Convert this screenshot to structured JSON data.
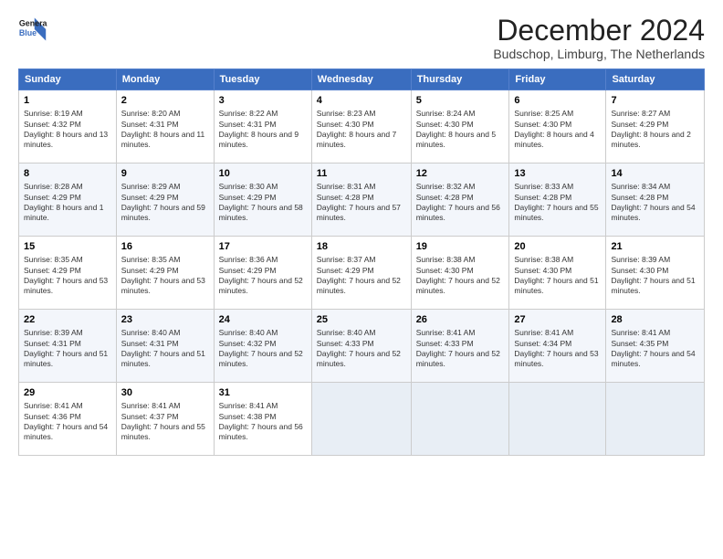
{
  "header": {
    "logo_line1": "General",
    "logo_line2": "Blue",
    "main_title": "December 2024",
    "subtitle": "Budschop, Limburg, The Netherlands"
  },
  "weekdays": [
    "Sunday",
    "Monday",
    "Tuesday",
    "Wednesday",
    "Thursday",
    "Friday",
    "Saturday"
  ],
  "weeks": [
    [
      {
        "day": "1",
        "sunrise": "8:19 AM",
        "sunset": "4:32 PM",
        "daylight": "8 hours and 13 minutes."
      },
      {
        "day": "2",
        "sunrise": "8:20 AM",
        "sunset": "4:31 PM",
        "daylight": "8 hours and 11 minutes."
      },
      {
        "day": "3",
        "sunrise": "8:22 AM",
        "sunset": "4:31 PM",
        "daylight": "8 hours and 9 minutes."
      },
      {
        "day": "4",
        "sunrise": "8:23 AM",
        "sunset": "4:30 PM",
        "daylight": "8 hours and 7 minutes."
      },
      {
        "day": "5",
        "sunrise": "8:24 AM",
        "sunset": "4:30 PM",
        "daylight": "8 hours and 5 minutes."
      },
      {
        "day": "6",
        "sunrise": "8:25 AM",
        "sunset": "4:30 PM",
        "daylight": "8 hours and 4 minutes."
      },
      {
        "day": "7",
        "sunrise": "8:27 AM",
        "sunset": "4:29 PM",
        "daylight": "8 hours and 2 minutes."
      }
    ],
    [
      {
        "day": "8",
        "sunrise": "8:28 AM",
        "sunset": "4:29 PM",
        "daylight": "8 hours and 1 minute."
      },
      {
        "day": "9",
        "sunrise": "8:29 AM",
        "sunset": "4:29 PM",
        "daylight": "7 hours and 59 minutes."
      },
      {
        "day": "10",
        "sunrise": "8:30 AM",
        "sunset": "4:29 PM",
        "daylight": "7 hours and 58 minutes."
      },
      {
        "day": "11",
        "sunrise": "8:31 AM",
        "sunset": "4:28 PM",
        "daylight": "7 hours and 57 minutes."
      },
      {
        "day": "12",
        "sunrise": "8:32 AM",
        "sunset": "4:28 PM",
        "daylight": "7 hours and 56 minutes."
      },
      {
        "day": "13",
        "sunrise": "8:33 AM",
        "sunset": "4:28 PM",
        "daylight": "7 hours and 55 minutes."
      },
      {
        "day": "14",
        "sunrise": "8:34 AM",
        "sunset": "4:28 PM",
        "daylight": "7 hours and 54 minutes."
      }
    ],
    [
      {
        "day": "15",
        "sunrise": "8:35 AM",
        "sunset": "4:29 PM",
        "daylight": "7 hours and 53 minutes."
      },
      {
        "day": "16",
        "sunrise": "8:35 AM",
        "sunset": "4:29 PM",
        "daylight": "7 hours and 53 minutes."
      },
      {
        "day": "17",
        "sunrise": "8:36 AM",
        "sunset": "4:29 PM",
        "daylight": "7 hours and 52 minutes."
      },
      {
        "day": "18",
        "sunrise": "8:37 AM",
        "sunset": "4:29 PM",
        "daylight": "7 hours and 52 minutes."
      },
      {
        "day": "19",
        "sunrise": "8:38 AM",
        "sunset": "4:30 PM",
        "daylight": "7 hours and 52 minutes."
      },
      {
        "day": "20",
        "sunrise": "8:38 AM",
        "sunset": "4:30 PM",
        "daylight": "7 hours and 51 minutes."
      },
      {
        "day": "21",
        "sunrise": "8:39 AM",
        "sunset": "4:30 PM",
        "daylight": "7 hours and 51 minutes."
      }
    ],
    [
      {
        "day": "22",
        "sunrise": "8:39 AM",
        "sunset": "4:31 PM",
        "daylight": "7 hours and 51 minutes."
      },
      {
        "day": "23",
        "sunrise": "8:40 AM",
        "sunset": "4:31 PM",
        "daylight": "7 hours and 51 minutes."
      },
      {
        "day": "24",
        "sunrise": "8:40 AM",
        "sunset": "4:32 PM",
        "daylight": "7 hours and 52 minutes."
      },
      {
        "day": "25",
        "sunrise": "8:40 AM",
        "sunset": "4:33 PM",
        "daylight": "7 hours and 52 minutes."
      },
      {
        "day": "26",
        "sunrise": "8:41 AM",
        "sunset": "4:33 PM",
        "daylight": "7 hours and 52 minutes."
      },
      {
        "day": "27",
        "sunrise": "8:41 AM",
        "sunset": "4:34 PM",
        "daylight": "7 hours and 53 minutes."
      },
      {
        "day": "28",
        "sunrise": "8:41 AM",
        "sunset": "4:35 PM",
        "daylight": "7 hours and 54 minutes."
      }
    ],
    [
      {
        "day": "29",
        "sunrise": "8:41 AM",
        "sunset": "4:36 PM",
        "daylight": "7 hours and 54 minutes."
      },
      {
        "day": "30",
        "sunrise": "8:41 AM",
        "sunset": "4:37 PM",
        "daylight": "7 hours and 55 minutes."
      },
      {
        "day": "31",
        "sunrise": "8:41 AM",
        "sunset": "4:38 PM",
        "daylight": "7 hours and 56 minutes."
      },
      null,
      null,
      null,
      null
    ]
  ],
  "labels": {
    "sunrise": "Sunrise:",
    "sunset": "Sunset:",
    "daylight": "Daylight:"
  }
}
